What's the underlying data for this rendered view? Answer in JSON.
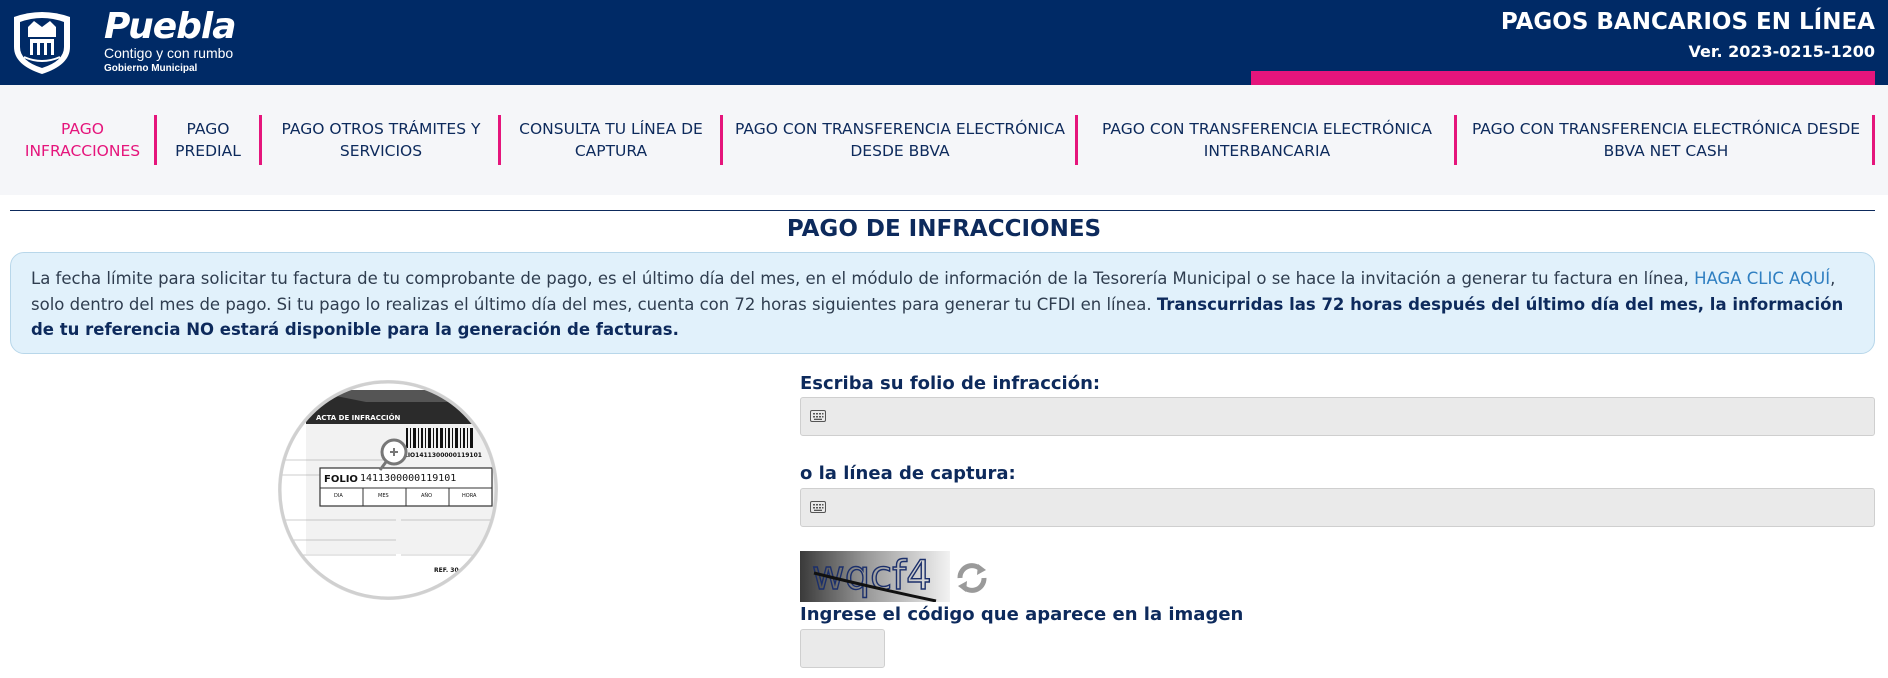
{
  "header": {
    "brand_name": "Puebla",
    "brand_tagline": "Contigo y con rumbo",
    "brand_gov": "Gobierno Municipal",
    "app_title": "PAGOS BANCARIOS EN LÍNEA",
    "version": "Ver. 2023-0215-1200"
  },
  "nav": {
    "items": [
      {
        "line1": "PAGO",
        "line2": "INFRACCIONES",
        "active": true
      },
      {
        "line1": "PAGO",
        "line2": "PREDIAL"
      },
      {
        "line1": "PAGO OTROS TRÁMITES Y",
        "line2": "SERVICIOS"
      },
      {
        "line1": "CONSULTA TU LÍNEA DE",
        "line2": "CAPTURA"
      },
      {
        "line1": "PAGO CON TRANSFERENCIA ELECTRÓNICA",
        "line2": "DESDE BBVA"
      },
      {
        "line1": "PAGO CON TRANSFERENCIA ELECTRÓNICA",
        "line2": "INTERBANCARIA"
      },
      {
        "line1": "PAGO CON TRANSFERENCIA ELECTRÓNICA DESDE",
        "line2": "BBVA NET CASH"
      }
    ]
  },
  "page_title": "PAGO DE INFRACCIONES",
  "notice": {
    "text_1": "La fecha límite para solicitar tu factura de tu comprobante de pago, es el último día del mes, en el módulo de información de la Tesorería Municipal o se hace la invitación a generar tu factura en línea, ",
    "link": "HAGA CLIC AQUÍ",
    "text_2": ", solo dentro del mes de pago. Si tu pago lo realizas el último día del mes, cuenta con 72 horas siguientes para generar tu CFDI en línea. ",
    "bold": "Transcurridas las 72 horas después del último día del mes, la información de tu referencia NO estará disponible para la generación de facturas."
  },
  "ticket": {
    "header": "ACTA DE INFRACCIÓN",
    "folio_label": "FOLIO",
    "folio_number": "1411300000119101",
    "folio_small": "1411300000119101",
    "folio_small_prefix": "LIO",
    "cols": [
      "DIA",
      "MES",
      "AÑO",
      "HORA"
    ],
    "ref": "REF. 30"
  },
  "form": {
    "folio_label": "Escriba su folio de infracción:",
    "folio_value": "",
    "linea_label": "o la línea de captura:",
    "linea_value": "",
    "captcha_text": "wqcf4",
    "captcha_label": "Ingrese el código que aparece en la imagen",
    "captcha_value": ""
  },
  "colors": {
    "header_bg": "#002a66",
    "accent_pink": "#e5157c",
    "notice_bg": "#e1f1fb",
    "link": "#2f7fc1"
  }
}
